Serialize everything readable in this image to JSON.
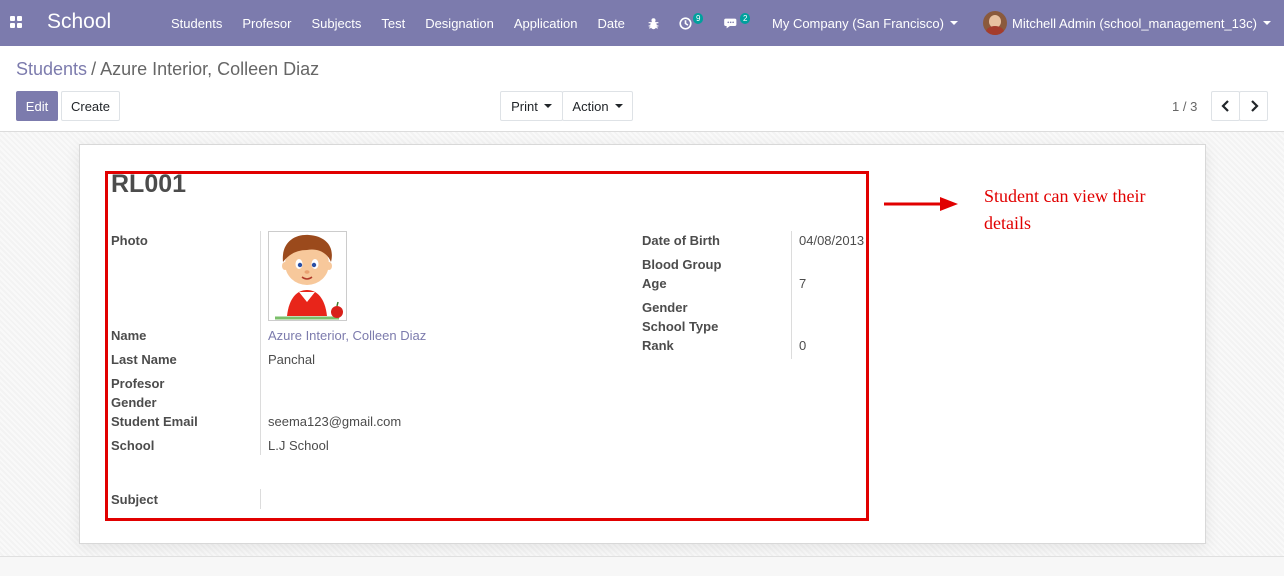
{
  "navbar": {
    "brand": "School",
    "menu": [
      "Students",
      "Profesor",
      "Subjects",
      "Test",
      "Designation",
      "Application",
      "Date"
    ],
    "activity_count": "9",
    "message_count": "2",
    "company": "My Company (San Francisco)",
    "user": "Mitchell Admin (school_management_13c)",
    "icons": {
      "apps": "apps-grid-icon",
      "debug": "bug-icon",
      "activity": "clock-icon",
      "messages": "chat-icon"
    }
  },
  "breadcrumb": {
    "parent": "Students",
    "separator": "/",
    "current": "Azure Interior, Colleen Diaz"
  },
  "control": {
    "edit": "Edit",
    "create": "Create",
    "print": "Print",
    "action": "Action",
    "pager": "1 / 3"
  },
  "form": {
    "title": "RL001",
    "left": {
      "photo_label": "Photo",
      "name_label": "Name",
      "name_value": "Azure Interior, Colleen Diaz",
      "last_name_label": "Last Name",
      "last_name_value": "Panchal",
      "profesor_label": "Profesor",
      "gender_label": "Gender",
      "email_label": "Student Email",
      "email_value": "seema123@gmail.com",
      "school_label": "School",
      "school_value": "L.J School",
      "subject_label": "Subject"
    },
    "right": {
      "dob_label": "Date of Birth",
      "dob_value": "04/08/2013",
      "blood_group_label": "Blood Group",
      "age_label": "Age",
      "age_value": "7",
      "gender_label": "Gender",
      "school_type_label": "School Type",
      "rank_label": "Rank",
      "rank_value": "0"
    }
  },
  "annotation": {
    "text": "Student can view their details",
    "color": "#e10000"
  },
  "colors": {
    "brand": "#7c7bad",
    "highlight": "#e10000"
  }
}
